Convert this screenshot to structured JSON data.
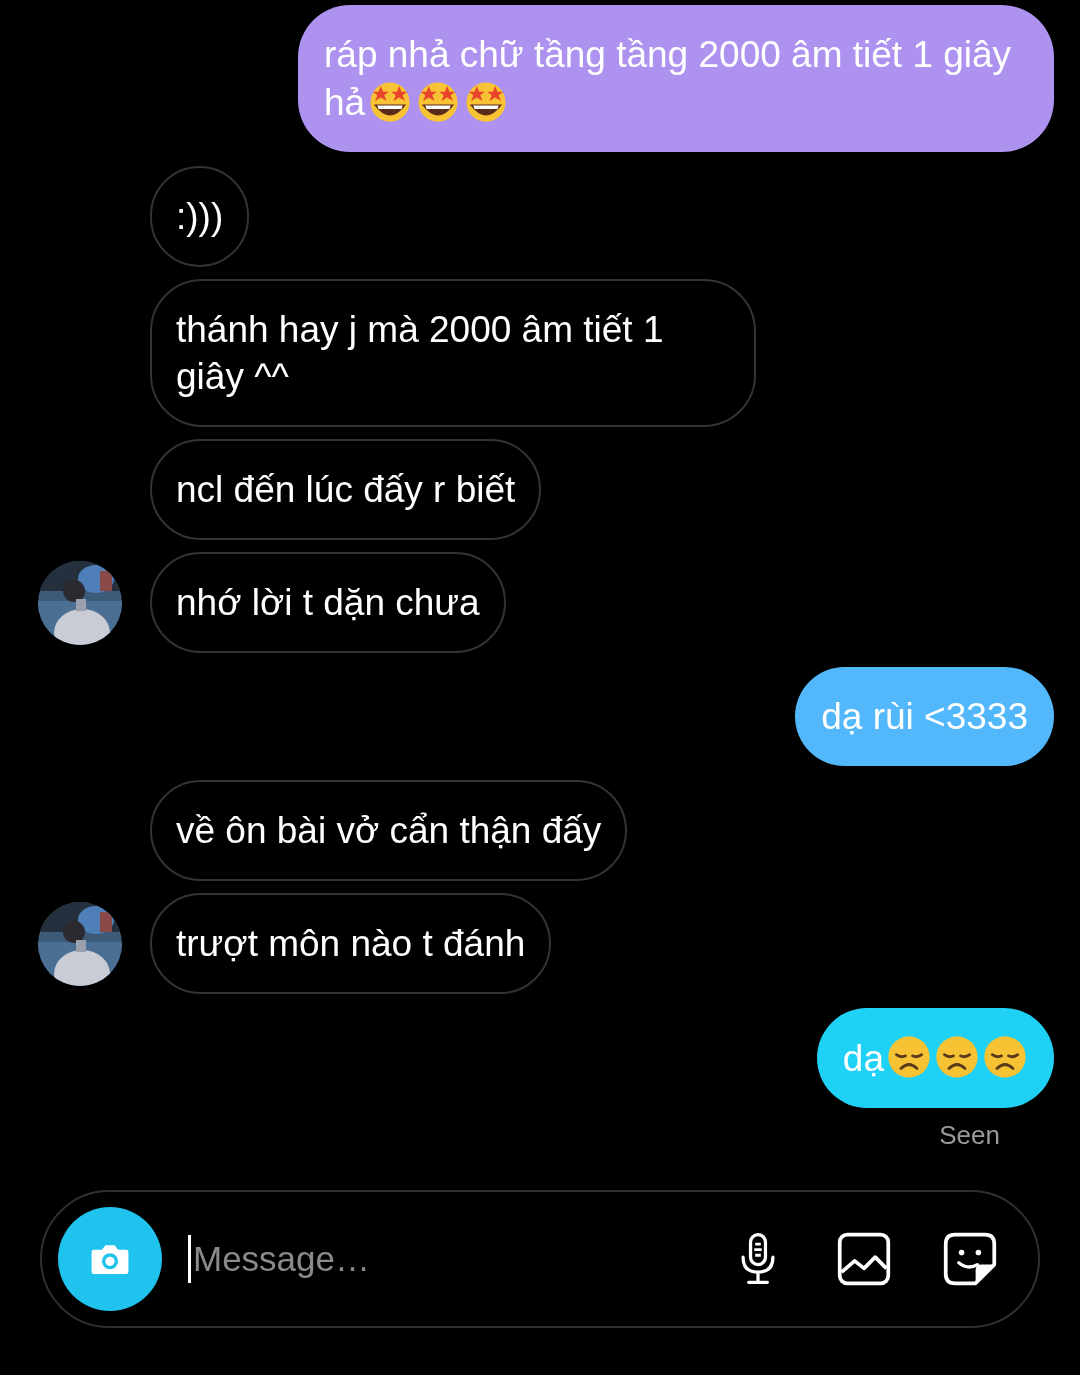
{
  "messages": [
    {
      "kind": "sent",
      "text": "ráp nhả chữ tầng tầng 2000 âm tiết 1 giây hả",
      "emoji": [
        {
          "kind": "star-struck"
        },
        {
          "kind": "star-struck"
        },
        {
          "kind": "star-struck"
        }
      ],
      "color": "#ad92f0"
    },
    {
      "kind": "received",
      "text": ":)))",
      "avatar": false
    },
    {
      "kind": "received",
      "text": "thánh hay j mà 2000 âm tiết 1 giây ^^",
      "avatar": false
    },
    {
      "kind": "received",
      "text": "ncl đến lúc đấy r biết",
      "avatar": false
    },
    {
      "kind": "received",
      "text": "nhớ lời t dặn chưa",
      "avatar": true
    },
    {
      "kind": "sent",
      "text": "dạ rùi <3333",
      "color": "#52b8fb"
    },
    {
      "kind": "received",
      "text": "về ôn bài vở cẩn thận đấy",
      "avatar": false
    },
    {
      "kind": "received",
      "text": "trượt môn nào t đánh",
      "avatar": true
    },
    {
      "kind": "sent",
      "text": "dạ",
      "emoji": [
        {
          "kind": "disappointed"
        },
        {
          "kind": "disappointed"
        },
        {
          "kind": "disappointed"
        }
      ],
      "color": "#1fd2f5"
    }
  ],
  "seen": "Seen",
  "composer": {
    "placeholder": "Message…"
  }
}
